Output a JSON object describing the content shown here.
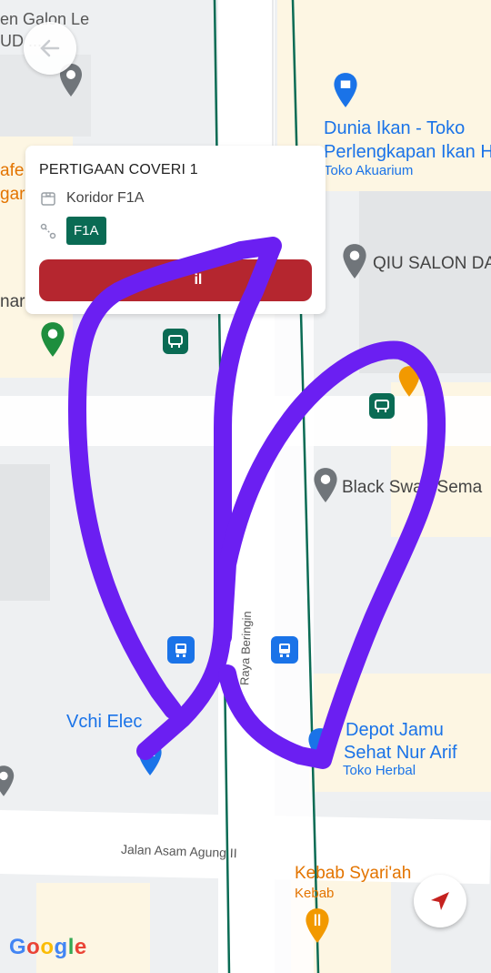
{
  "map": {
    "labels": {
      "top_left_1": "en Galon Le",
      "top_left_2": "UD ...",
      "dunia_1": "Dunia Ikan - Toko",
      "dunia_2": "Perlengkapan Ikan H",
      "dunia_cat": "Toko Akuarium",
      "cafe_1": "afe",
      "cafe_2": "gar",
      "nar": "nar",
      "qiu": "QIU SALON DA",
      "black_swan": "Black Swan Sema",
      "vchi": "Vchi Elec",
      "road_vertical": "Raya Beringin",
      "depot_1": "Depot Jamu",
      "depot_2": "Sehat Nur Arif",
      "depot_cat": "Toko Herbal",
      "road_horizontal": "Jalan Asam Agung II",
      "kebab": "Kebab Syari'ah",
      "kebab_cat": "Kebab"
    },
    "google_logo": "Google",
    "colors": {
      "route_green": "#0a6b54",
      "annotation_purple": "#6b1ff2",
      "poi_blue": "#1a73e8",
      "poi_orange": "#e37400"
    }
  },
  "card": {
    "title": "PERTIGAAN COVERI 1",
    "corridor": "Koridor F1A",
    "badge": "F1A",
    "button": "Lihat detail",
    "button_visible": "Li        il"
  },
  "icons": {
    "back": "arrow-left-icon",
    "locate": "navigation-arrow-icon"
  }
}
